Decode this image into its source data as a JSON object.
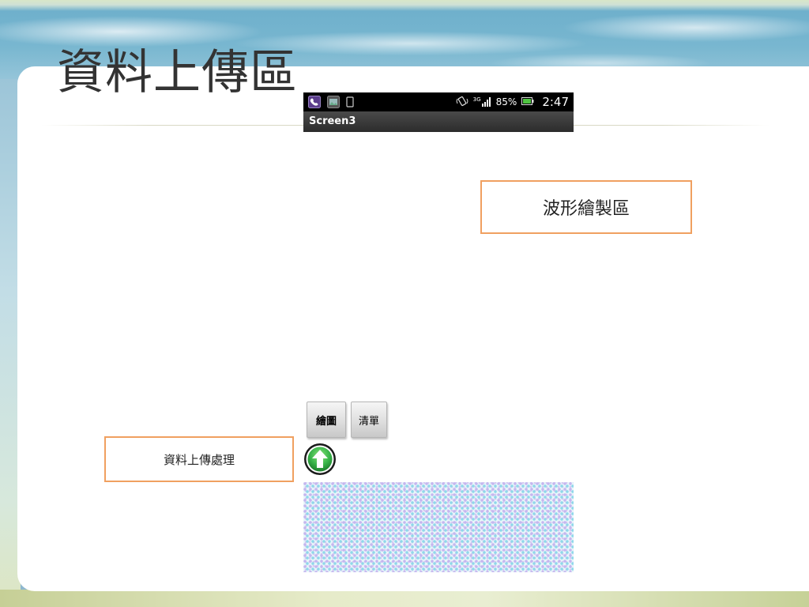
{
  "slide": {
    "title": "資料上傳區"
  },
  "phone": {
    "status_bar": {
      "left_icons": [
        "phone-app-icon",
        "gallery-notification-icon",
        "device-notification-icon"
      ],
      "right_icons": [
        "vibrate-icon",
        "signal-3g-icon",
        "battery-icon"
      ],
      "network": "3G",
      "battery_percent": "85%",
      "time": "2:47"
    },
    "screen_title": "Screen3",
    "buttons": {
      "draw_label": "繪圖",
      "list_label": "清單"
    },
    "upload_icon": "up-arrow-icon"
  },
  "callouts": {
    "waveform_area": "波形繪製區",
    "upload_processing": "資料上傳處理"
  },
  "colors": {
    "callout_border": "#f0a060",
    "upload_icon_green": "#39b54a",
    "status_bar_bg": "#000000"
  }
}
